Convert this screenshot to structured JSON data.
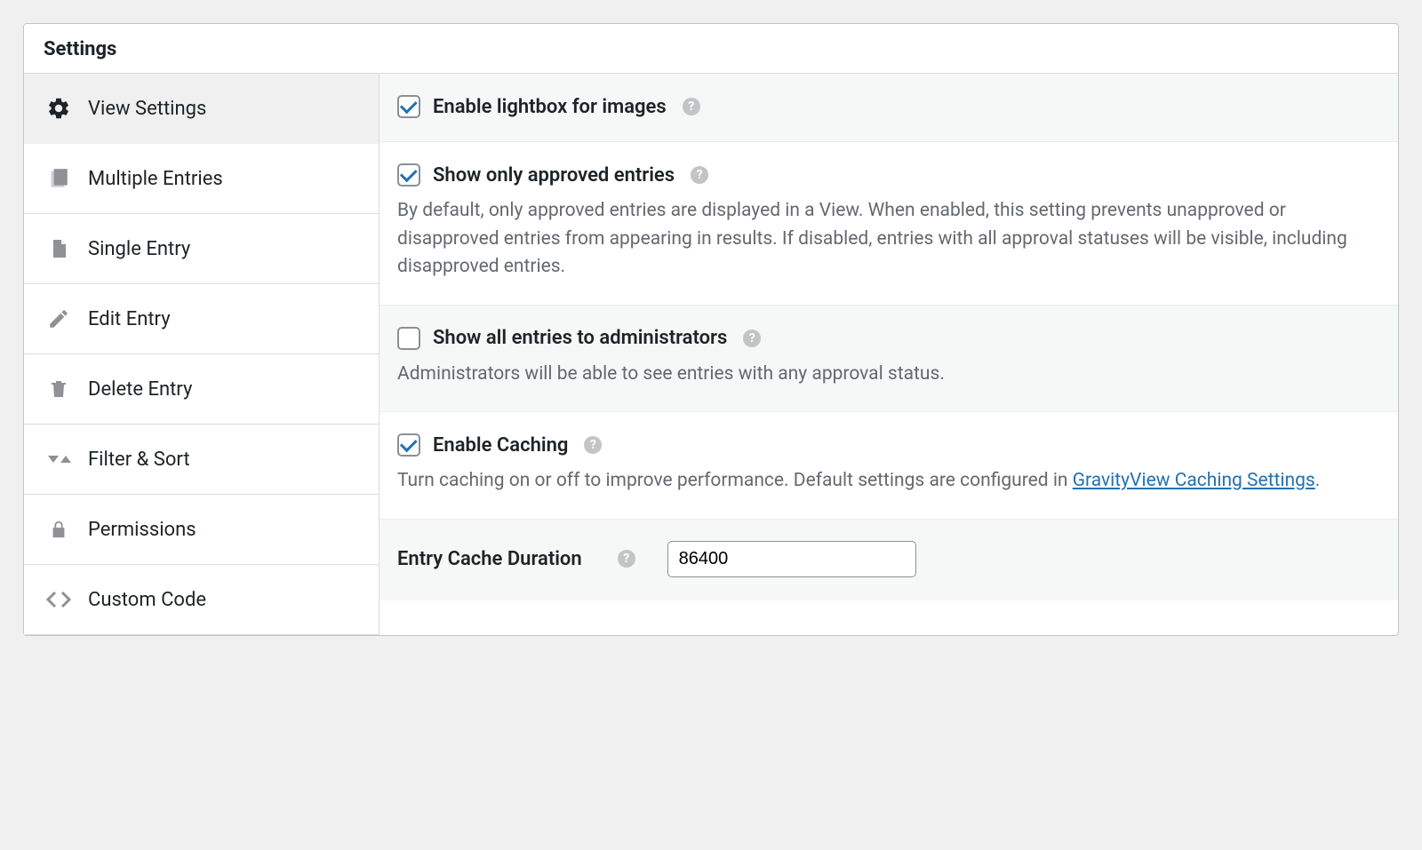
{
  "header": {
    "title": "Settings"
  },
  "tabs": [
    {
      "label": "View Settings"
    },
    {
      "label": "Multiple Entries"
    },
    {
      "label": "Single Entry"
    },
    {
      "label": "Edit Entry"
    },
    {
      "label": "Delete Entry"
    },
    {
      "label": "Filter & Sort"
    },
    {
      "label": "Permissions"
    },
    {
      "label": "Custom Code"
    }
  ],
  "settings": {
    "lightbox": {
      "label": "Enable lightbox for images"
    },
    "approved": {
      "label": "Show only approved entries",
      "desc": "By default, only approved entries are displayed in a View. When enabled, this setting prevents unapproved or disapproved entries from appearing in results. If disabled, entries with all approval statuses will be visible, including disapproved entries."
    },
    "admin_all": {
      "label": "Show all entries to administrators",
      "desc": "Administrators will be able to see entries with any approval status."
    },
    "caching": {
      "label": "Enable Caching",
      "desc_prefix": "Turn caching on or off to improve performance. Default settings are configured in ",
      "link_text": "GravityView Caching Settings",
      "desc_suffix": "."
    },
    "cache_duration": {
      "label": "Entry Cache Duration",
      "value": "86400"
    }
  }
}
